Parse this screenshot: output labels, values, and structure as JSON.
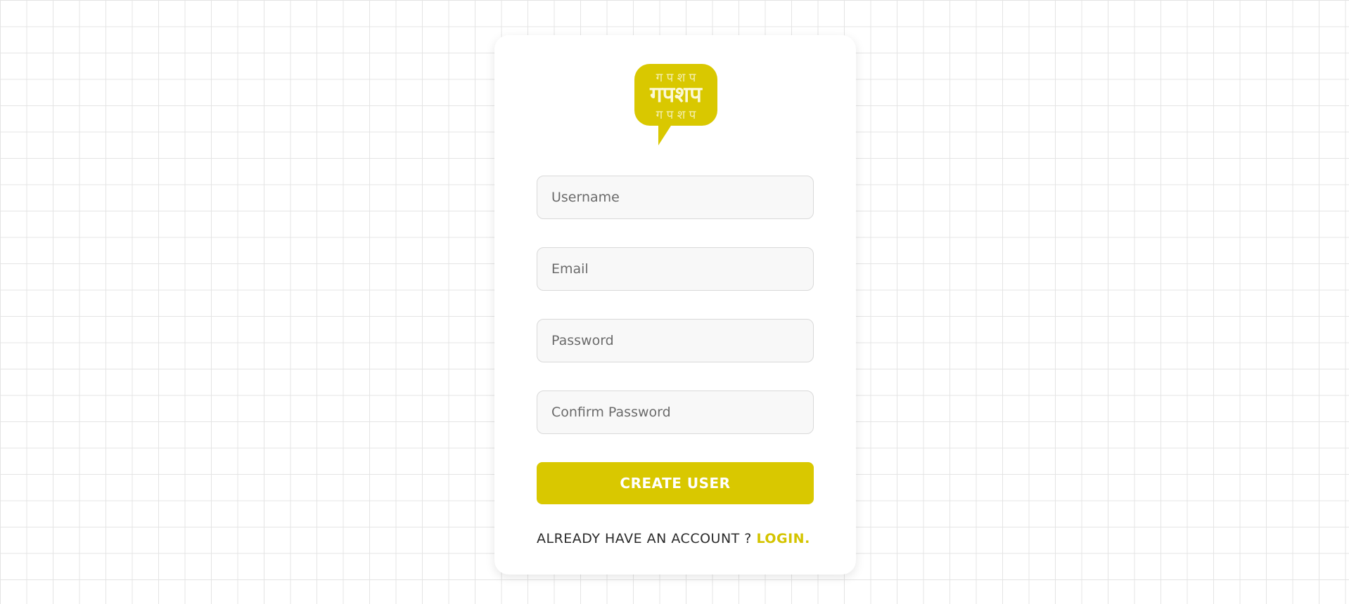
{
  "brand": {
    "logo_rows": [
      "ग प श प",
      "गपशप",
      "ग प श प"
    ],
    "color": "#d9c800"
  },
  "form": {
    "username_placeholder": "Username",
    "email_placeholder": "Email",
    "password_placeholder": "Password",
    "confirm_password_placeholder": "Confirm Password",
    "submit_label": "CREATE USER"
  },
  "footer": {
    "prompt": "ALREADY HAVE AN ACCOUNT ? ",
    "login_label": "LOGIN."
  }
}
